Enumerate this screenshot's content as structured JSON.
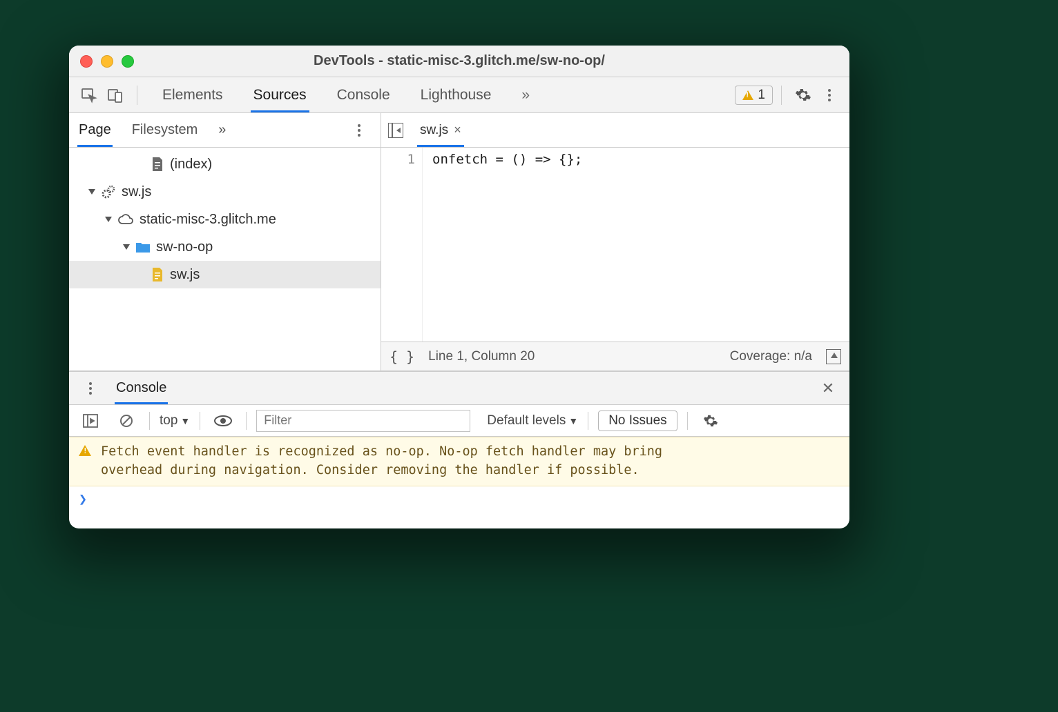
{
  "window": {
    "title": "DevTools - static-misc-3.glitch.me/sw-no-op/"
  },
  "toolbar": {
    "tabs": [
      "Elements",
      "Sources",
      "Console",
      "Lighthouse"
    ],
    "active_tab": "Sources",
    "warning_count": "1"
  },
  "sources": {
    "nav_tabs": [
      "Page",
      "Filesystem"
    ],
    "active_nav": "Page",
    "tree": {
      "index_label": "(index)",
      "sw_worker": "sw.js",
      "domain": "static-misc-3.glitch.me",
      "folder": "sw-no-op",
      "file": "sw.js"
    },
    "open_file": "sw.js",
    "code": {
      "line_number": "1",
      "content": "onfetch = () => {};"
    },
    "status": {
      "pretty": "{ }",
      "position": "Line 1, Column 20",
      "coverage": "Coverage: n/a"
    }
  },
  "drawer": {
    "tab": "Console",
    "context": "top",
    "filter_placeholder": "Filter",
    "levels": "Default levels",
    "issues": "No Issues",
    "warning": "Fetch event handler is recognized as no-op. No-op fetch handler may bring overhead during navigation. Consider removing the handler if possible.",
    "prompt": "❯"
  }
}
